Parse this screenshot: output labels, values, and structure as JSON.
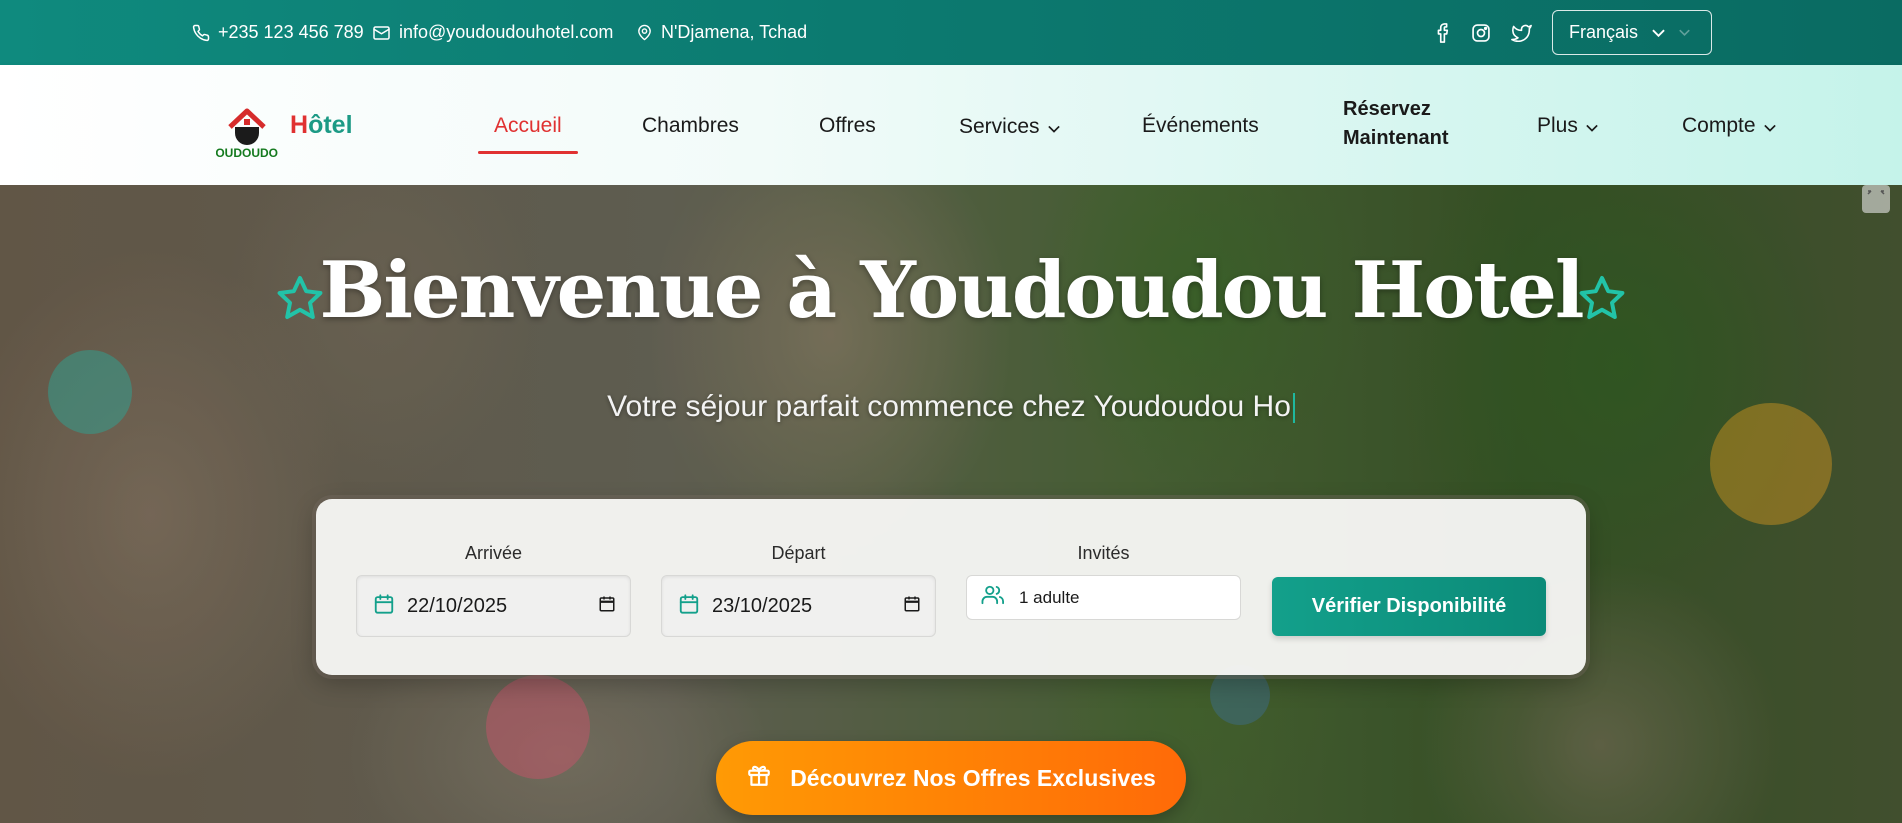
{
  "topbar": {
    "phone": "+235 123 456 789",
    "email": "info@youdoudouhotel.com",
    "location": "N'Djamena, Tchad",
    "social": [
      "facebook-icon",
      "instagram-icon",
      "twitter-icon"
    ],
    "language": "Français"
  },
  "brand": {
    "logo_text": "YOUDOUDOU",
    "name_first": "H",
    "name_rest": "ôtel",
    "colors": {
      "red": "#e03131",
      "teal": "#1c9a85"
    }
  },
  "nav": {
    "items": [
      {
        "label": "Accueil",
        "active": true
      },
      {
        "label": "Chambres"
      },
      {
        "label": "Offres"
      },
      {
        "label": "Services",
        "dropdown": true
      },
      {
        "label": "Événements"
      },
      {
        "label": "Plus",
        "dropdown": true
      },
      {
        "label": "Compte",
        "dropdown": true
      }
    ],
    "reserve_line1": "Réservez",
    "reserve_line2": "Maintenant"
  },
  "hero": {
    "title": "Bienvenue à Youdoudou Hotel",
    "subtitle": "Votre séjour parfait commence chez Youdoudou Ho"
  },
  "booking": {
    "arrival_label": "Arrivée",
    "arrival_value": "22/10/2025",
    "departure_label": "Départ",
    "departure_value": "23/10/2025",
    "guests_label": "Invités",
    "guests_value": "1 adulte",
    "check_button": "Vérifier Disponibilité"
  },
  "offers_button": "Découvrez Nos Offres Exclusives",
  "colors": {
    "topbar": "#0c7a70",
    "accent_teal": "#0f9a85",
    "accent_red": "#e03131",
    "accent_orange": "#ff8305"
  }
}
